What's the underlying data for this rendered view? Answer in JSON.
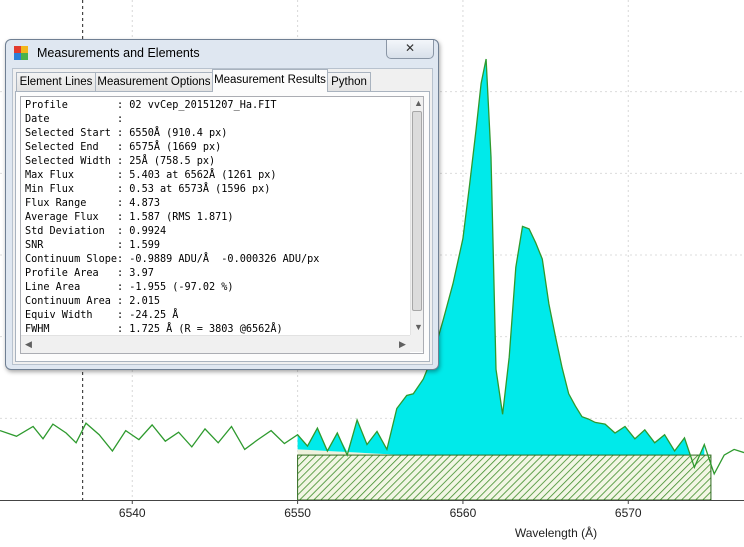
{
  "chart_data": {
    "type": "line",
    "xlabel": "Wavelength (Å)",
    "xlim": [
      6532,
      6577
    ],
    "ylim": [
      0,
      6.0
    ],
    "x_ticks": [
      "6540",
      "6550",
      "6560",
      "6570"
    ],
    "grid": true,
    "selection": {
      "start": 6550,
      "end": 6575
    },
    "cursor_x": 6537,
    "series": [
      {
        "color": "#2e9a2e",
        "fill": "#00eaea",
        "x": [
          6532.0,
          6533.0,
          6534.0,
          6534.6,
          6535.2,
          6536.0,
          6536.6,
          6537.2,
          6538.0,
          6538.8,
          6539.6,
          6540.4,
          6541.2,
          6542.0,
          6542.8,
          6543.6,
          6544.4,
          6545.2,
          6546.0,
          6546.8,
          6547.6,
          6548.4,
          6549.2,
          6550.0,
          6550.6,
          6551.2,
          6551.8,
          6552.4,
          6553.0,
          6553.6,
          6554.2,
          6554.8,
          6555.4,
          6556.0,
          6556.6,
          6557.0,
          6557.6,
          6558.2,
          6558.8,
          6559.4,
          6560.0,
          6560.4,
          6560.8,
          6561.1,
          6561.4,
          6561.7,
          6562.0,
          6562.4,
          6562.8,
          6563.2,
          6563.6,
          6564.0,
          6564.4,
          6564.8,
          6565.2,
          6565.6,
          6566.0,
          6566.4,
          6566.8,
          6567.2,
          6567.6,
          6568.0,
          6568.6,
          6569.2,
          6569.8,
          6570.4,
          6571.0,
          6571.6,
          6572.2,
          6572.8,
          6573.4,
          6574.0,
          6574.6,
          6575.2,
          6575.8,
          6576.4,
          6577.0
        ],
        "y": [
          0.85,
          0.78,
          0.9,
          0.75,
          0.93,
          0.82,
          0.7,
          0.94,
          0.8,
          0.6,
          0.85,
          0.74,
          0.92,
          0.72,
          0.83,
          0.65,
          0.87,
          0.7,
          0.9,
          0.62,
          0.74,
          0.85,
          0.69,
          0.8,
          0.66,
          0.88,
          0.6,
          0.82,
          0.55,
          0.98,
          0.68,
          0.84,
          0.62,
          1.12,
          1.28,
          1.3,
          1.48,
          1.78,
          2.2,
          2.65,
          3.2,
          3.85,
          4.55,
          5.1,
          5.4,
          4.2,
          1.6,
          1.05,
          1.75,
          2.85,
          3.35,
          3.32,
          3.15,
          2.95,
          2.4,
          2.0,
          1.62,
          1.3,
          1.15,
          1.02,
          0.99,
          0.95,
          0.93,
          0.82,
          0.9,
          0.75,
          0.86,
          0.7,
          0.8,
          0.6,
          0.76,
          0.4,
          0.68,
          0.32,
          0.55,
          0.62,
          0.58
        ]
      }
    ]
  },
  "dialog": {
    "title": "Measurements and Elements",
    "close_glyph": "✕",
    "tabs": [
      "Element Lines",
      "Measurement Options",
      "Measurement Results",
      "Python"
    ],
    "active_tab": "Measurement Results",
    "results": [
      {
        "label": "Profile",
        "value": "02 vvCep_20151207_Ha.FIT"
      },
      {
        "label": "Date",
        "value": ""
      },
      {
        "label": "Selected Start",
        "value": "6550Å (910.4 px)"
      },
      {
        "label": "Selected End",
        "value": "6575Å (1669 px)"
      },
      {
        "label": "Selected Width",
        "value": "25Å (758.5 px)"
      },
      {
        "label": "Max Flux",
        "value": "5.403 at 6562Å (1261 px)"
      },
      {
        "label": "Min Flux",
        "value": "0.53 at 6573Å (1596 px)"
      },
      {
        "label": "Flux Range",
        "value": "4.873"
      },
      {
        "label": "Average Flux",
        "value": "1.587 (RMS 1.871)"
      },
      {
        "label": "Std Deviation",
        "value": "0.9924"
      },
      {
        "label": "SNR",
        "value": "1.599"
      },
      {
        "label": "Continuum Slope",
        "value": "-0.9889 ADU/Å  -0.000326 ADU/px"
      },
      {
        "label": "Profile Area",
        "value": "3.97"
      },
      {
        "label": "Line Area",
        "value": "-1.955 (-97.02 %)"
      },
      {
        "label": "Continuum Area",
        "value": "2.015"
      },
      {
        "label": "Equiv Width",
        "value": "-24.25 Å"
      },
      {
        "label": "FWHM",
        "value": "1.725 Å (R = 3803 @6562Å)"
      }
    ]
  }
}
